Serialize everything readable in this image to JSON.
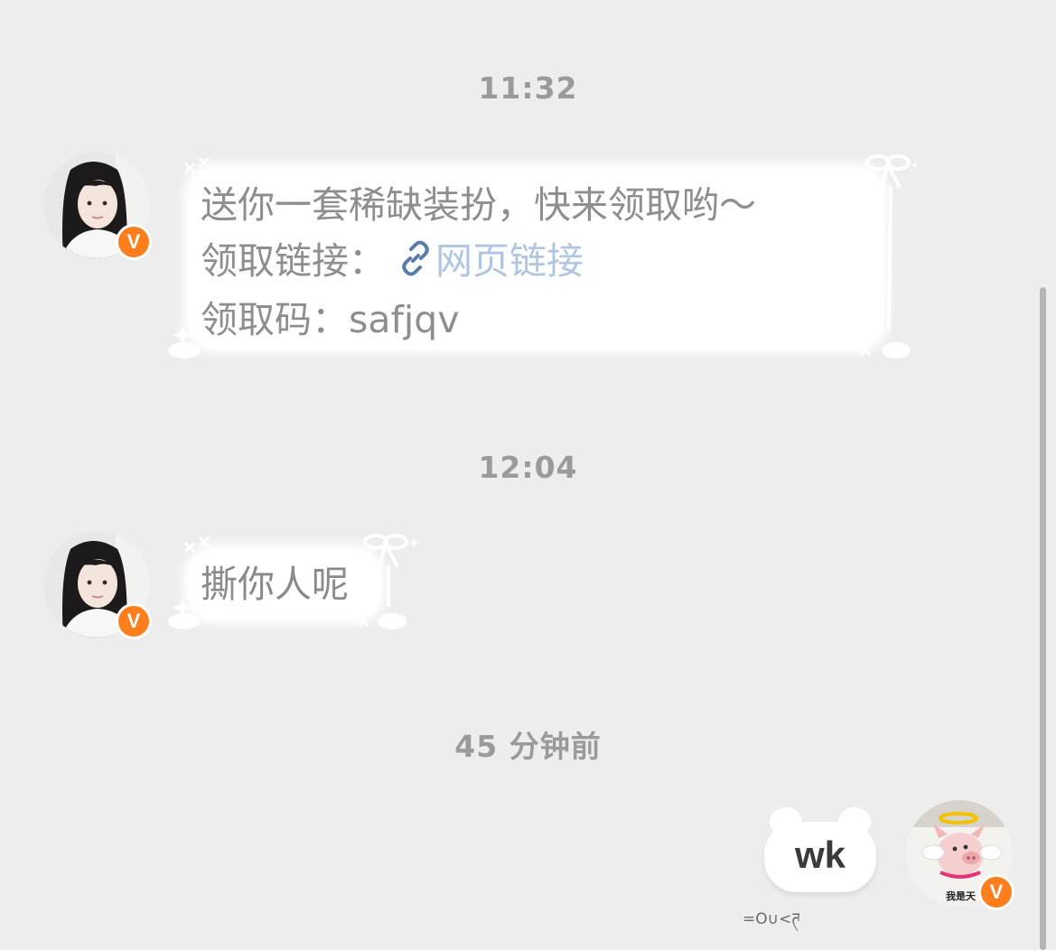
{
  "timestamps": {
    "first": "11:32",
    "second": "12:04",
    "third": "45 分钟前"
  },
  "messages": {
    "first": {
      "line1": "送你一套稀缺装扮，快来领取哟～",
      "line2_label": "领取链接：",
      "line2_link": "网页链接",
      "line3": "领取码：safjqv"
    },
    "second": {
      "text": "撕你人呢"
    },
    "sent": {
      "text": "wk",
      "decoration": "=O∪<ཊ"
    }
  },
  "badges": {
    "verified_mark": "V",
    "pig_caption": "我是天"
  },
  "colors": {
    "background": "#ededed",
    "bubble": "#ffffff",
    "message_text": "#8e8e8e",
    "link_text": "#aec5e3",
    "timestamp_text": "#9a9a9a",
    "badge_orange": "#ff7e1c"
  },
  "icons": {
    "link": "link-chain-icon",
    "verified": "verified-v-badge-icon"
  }
}
